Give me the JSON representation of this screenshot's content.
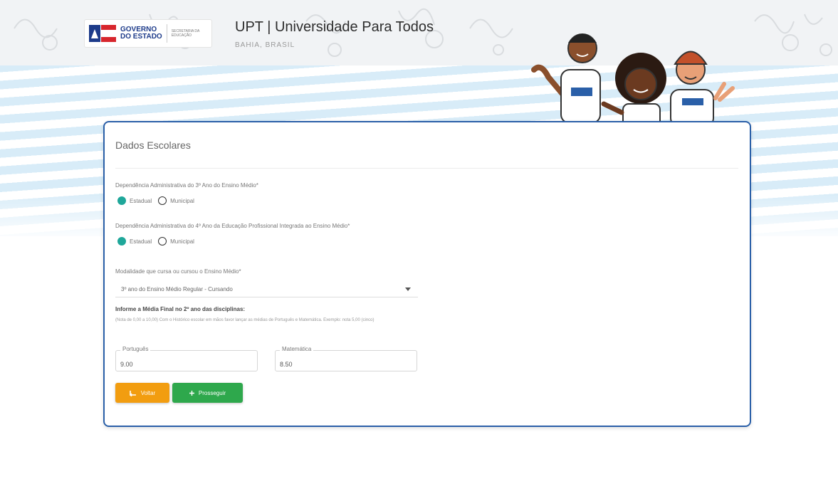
{
  "header": {
    "logo_line1": "GOVERNO",
    "logo_line2": "DO ESTADO",
    "logo_sub": "SECRETARIA DA EDUCAÇÃO",
    "title": "UPT | Universidade Para Todos",
    "subtitle": "BAHIA, BRASIL"
  },
  "card": {
    "title": "Dados Escolares",
    "dep3": {
      "label": "Dependência Administrativa do 3º Ano do Ensino Médio*",
      "options": [
        "Estadual",
        "Municipal"
      ],
      "selected": "Estadual"
    },
    "dep4": {
      "label": "Dependência Administrativa do 4º Ano da Educação Profissional Integrada ao Ensino Médio*",
      "options": [
        "Estadual",
        "Municipal"
      ],
      "selected": "Estadual"
    },
    "modalidade": {
      "label": "Modalidade que cursa ou cursou o Ensino Médio*",
      "value": "3º ano do Ensino Médio Regular - Cursando"
    },
    "informe": {
      "title": "Informe a Média Final no 2º ano das disciplinas:",
      "help": "(Nota de 0,00 a 10,00) Com o Histórico escolar em mãos favor lançar as médias de Português e Matemática. Exemplo: nota 5,00 (cinco)"
    },
    "portugues": {
      "label": "Português",
      "value": "9.00"
    },
    "matematica": {
      "label": "Matemática",
      "value": "8.50"
    },
    "buttons": {
      "back": "Voltar",
      "next": "Prosseguir"
    }
  },
  "colors": {
    "card_border": "#2a5fa8",
    "radio_checked": "#1fa79a",
    "back_button": "#f29d10",
    "next_button": "#2ea84c",
    "stripe": "#d8ecf8"
  }
}
